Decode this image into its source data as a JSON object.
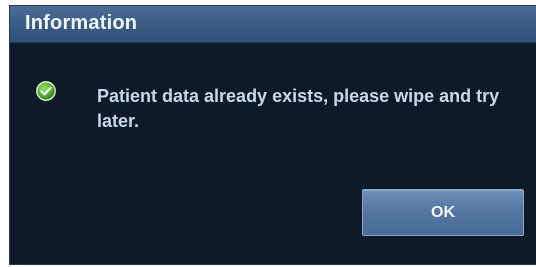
{
  "dialog": {
    "title": "Information",
    "icon": "check-circle-icon",
    "message": "Patient data already exists, please wipe and try later.",
    "ok_label": "OK"
  },
  "colors": {
    "titlebar": "#3a5b82",
    "background": "#0f1a28",
    "icon": "#5cc23a",
    "button": "#5478a3"
  }
}
